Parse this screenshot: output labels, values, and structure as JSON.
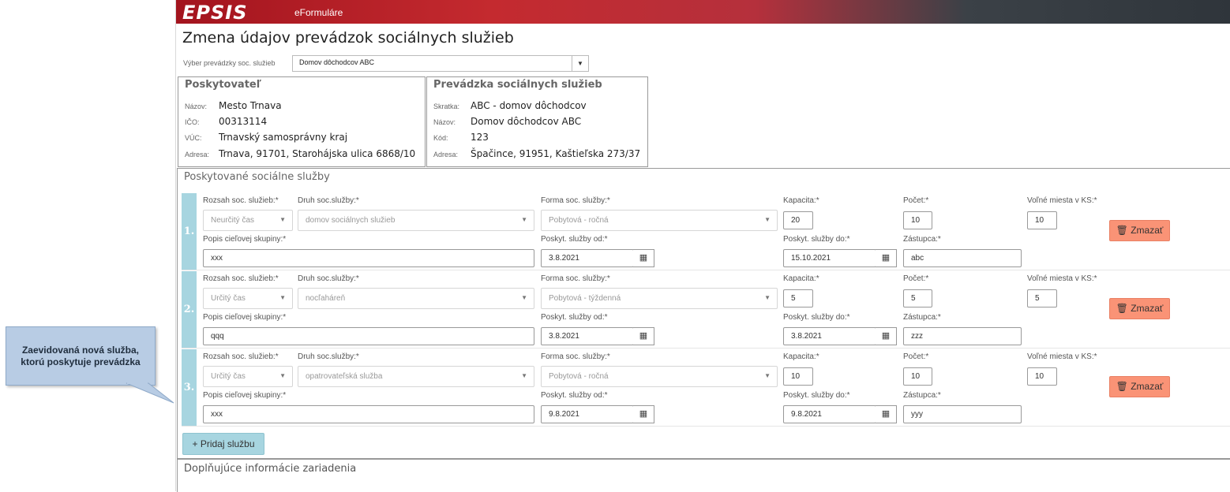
{
  "header": {
    "logo": "EPSIS",
    "app_name": "eFormuláre"
  },
  "page_title": "Zmena údajov prevádzok sociálnych služieb",
  "selector": {
    "label": "Výber prevádzky soc. služieb",
    "value": "Domov dôchodcov ABC"
  },
  "provider": {
    "title": "Poskytovateľ",
    "fields": [
      {
        "key": "Názov:",
        "value": "Mesto Trnava"
      },
      {
        "key": "IČO:",
        "value": "00313114"
      },
      {
        "key": "VÚC:",
        "value": "Trnavský samosprávny kraj"
      },
      {
        "key": "Adresa:",
        "value": "Trnava, 91701, Starohájska ulica 6868/10"
      }
    ]
  },
  "facility": {
    "title": "Prevádzka sociálnych služieb",
    "fields": [
      {
        "key": "Skratka:",
        "value": "ABC - domov dôchodcov"
      },
      {
        "key": "Názov:",
        "value": "Domov dôchodcov ABC"
      },
      {
        "key": "Kód:",
        "value": "123"
      },
      {
        "key": "Adresa:",
        "value": "Špačince, 91951, Kaštieľska 273/37"
      }
    ]
  },
  "services": {
    "title": "Poskytované sociálne služby",
    "labels": {
      "scope": "Rozsah soc. služieb:*",
      "type": "Druh soc.služby:*",
      "form": "Forma soc. služby:*",
      "capacity": "Kapacita:*",
      "count": "Počet:*",
      "free": "Voľné miesta v KS:*",
      "target": "Popis cieľovej skupiny:*",
      "from": "Poskyt. služby od:*",
      "to": "Poskyt. služby do:*",
      "deputy": "Zástupca:*"
    },
    "delete_label": "Zmazať",
    "add_label": "Pridaj službu",
    "rows": [
      {
        "num": "1.",
        "scope": "Neurčitý čas",
        "type": "domov sociálnych služieb",
        "form": "Pobytová - ročná",
        "capacity": "20",
        "count": "10",
        "free": "10",
        "target": "xxx",
        "from": "3.8.2021",
        "to": "15.10.2021",
        "deputy": "abc"
      },
      {
        "num": "2.",
        "scope": "Určitý čas",
        "type": "nocľaháreň",
        "form": "Pobytová - týždenná",
        "capacity": "5",
        "count": "5",
        "free": "5",
        "target": "qqq",
        "from": "3.8.2021",
        "to": "3.8.2021",
        "deputy": "zzz"
      },
      {
        "num": "3.",
        "scope": "Určitý čas",
        "type": "opatrovateľská služba",
        "form": "Pobytová - ročná",
        "capacity": "10",
        "count": "10",
        "free": "10",
        "target": "xxx",
        "from": "9.8.2021",
        "to": "9.8.2021",
        "deputy": "yyy"
      }
    ]
  },
  "extra_title": "Doplňujúce informácie zariadenia",
  "callout": {
    "line1": "Zaevidovaná nová služba,",
    "line2": "ktorú poskytuje prevádzka"
  },
  "colors": {
    "header_red": "#a3141e",
    "row_accent": "#a7d5e0",
    "delete_button": "#fa9376"
  }
}
